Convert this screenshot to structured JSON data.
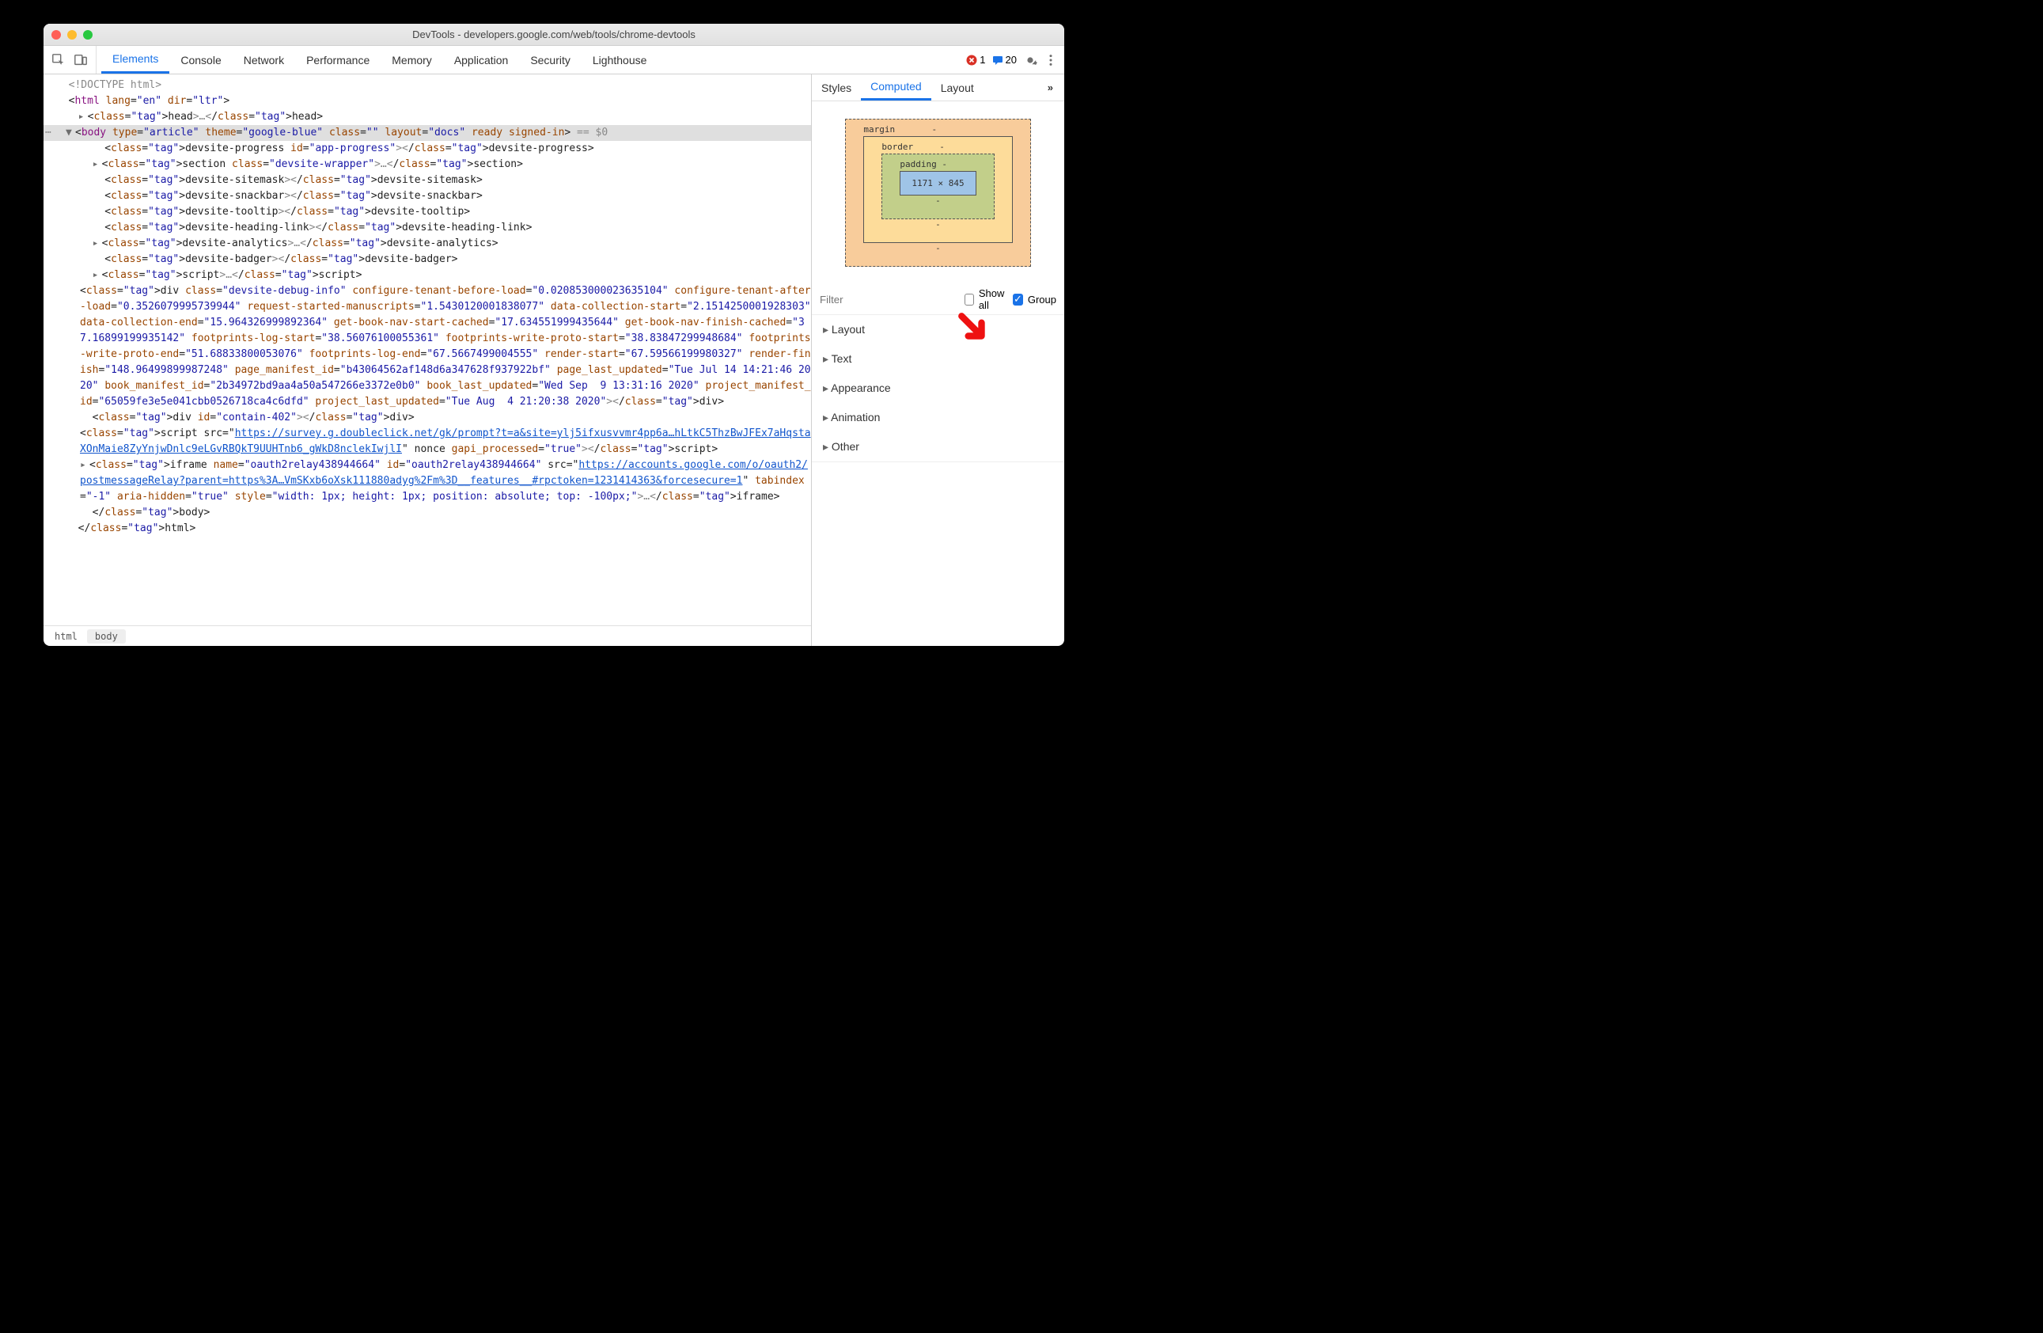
{
  "window": {
    "title": "DevTools - developers.google.com/web/tools/chrome-devtools"
  },
  "tabs": {
    "items": [
      "Elements",
      "Console",
      "Network",
      "Performance",
      "Memory",
      "Application",
      "Security",
      "Lighthouse"
    ],
    "active": "Elements"
  },
  "status": {
    "errors": "1",
    "messages": "20"
  },
  "breadcrumbs": {
    "items": [
      "html",
      "body"
    ],
    "selected": "body"
  },
  "side": {
    "tabs": [
      "Styles",
      "Computed",
      "Layout"
    ],
    "active": "Computed",
    "more": "»",
    "box_model": {
      "margin_label": "margin",
      "border_label": "border",
      "padding_label": "padding",
      "content": "1171 × 845",
      "dash": "-"
    },
    "filter": {
      "placeholder": "Filter",
      "show_all_label": "Show all",
      "show_all_checked": false,
      "group_label": "Group",
      "group_checked": true
    },
    "accordion": [
      "Layout",
      "Text",
      "Appearance",
      "Animation",
      "Other"
    ]
  },
  "dom": {
    "doctype": "<!DOCTYPE html>",
    "html_open": {
      "tag": "html",
      "attrs": [
        [
          "lang",
          "en"
        ],
        [
          "dir",
          "ltr"
        ]
      ]
    },
    "head": "<head>…</head>",
    "body_line": {
      "tag": "body",
      "attrs": [
        [
          "type",
          "article"
        ],
        [
          "theme",
          "google-blue"
        ],
        [
          "class",
          ""
        ],
        [
          "layout",
          "docs"
        ],
        [
          "ready",
          null
        ],
        [
          "signed-in",
          null
        ]
      ],
      "suffix": " == $0"
    },
    "children": [
      {
        "raw": "<devsite-progress id=\"app-progress\"></devsite-progress>"
      },
      {
        "arrow": "▸",
        "raw": "<section class=\"devsite-wrapper\">…</section>"
      },
      {
        "raw": "<devsite-sitemask></devsite-sitemask>"
      },
      {
        "raw": "<devsite-snackbar></devsite-snackbar>"
      },
      {
        "raw": "<devsite-tooltip></devsite-tooltip>"
      },
      {
        "raw": "<devsite-heading-link></devsite-heading-link>"
      },
      {
        "arrow": "▸",
        "raw": "<devsite-analytics>…</devsite-analytics>"
      },
      {
        "raw": "<devsite-badger></devsite-badger>"
      },
      {
        "arrow": "▸",
        "raw": "<script>…</script>"
      }
    ],
    "debug_div": "<div class=\"devsite-debug-info\" configure-tenant-before-load=\"0.020853000023635104\" configure-tenant-after-load=\"0.3526079995739944\" request-started-manuscripts=\"1.5430120001838077\" data-collection-start=\"2.1514250001928303\" data-collection-end=\"15.964326999892364\" get-book-nav-start-cached=\"17.634551999435644\" get-book-nav-finish-cached=\"37.16899199935142\" footprints-log-start=\"38.56076100055361\" footprints-write-proto-start=\"38.83847299948684\" footprints-write-proto-end=\"51.68833800053076\" footprints-log-end=\"67.5667499004555\" render-start=\"67.59566199980327\" render-finish=\"148.96499899987248\" page_manifest_id=\"b43064562af148d6a347628f937922bf\" page_last_updated=\"Tue Jul 14 14:21:46 2020\" book_manifest_id=\"2b34972bd9aa4a50a547266e3372e0b0\" book_last_updated=\"Wed Sep  9 13:31:16 2020\" project_manifest_id=\"65059fe3e5e041cbb0526718ca4c6dfd\" project_last_updated=\"Tue Aug  4 21:20:38 2020\"></div>",
    "contain_div": "<div id=\"contain-402\"></div>",
    "script_src": {
      "prefix": "<script src=\"",
      "url": "https://survey.g.doubleclick.net/gk/prompt?t=a&site=ylj5ifxusvvmr4pp6a…hLtkC5ThzBwJFEx7aHqstaXOnMaie8ZyYnjwDnlc9eLGvRBQkT9UUHTnb6_gWkD8nclekIwjlI",
      "suffix": "\" nonce gapi_processed=\"true\"></script>"
    },
    "iframe": {
      "prefix": "<iframe name=\"oauth2relay438944664\" id=\"oauth2relay438944664\" src=\"",
      "url": "https://accounts.google.com/o/oauth2/postmessageRelay?parent=https%3A…VmSKxb6oXsk111880adyg%2Fm%3D__features__#rpctoken=1231414363&forcesecure=1",
      "suffix": "\" tabindex=\"-1\" aria-hidden=\"true\" style=\"width: 1px; height: 1px; position: absolute; top: -100px;\">…</iframe>"
    },
    "body_close": "</body>",
    "html_close": "</html>"
  }
}
